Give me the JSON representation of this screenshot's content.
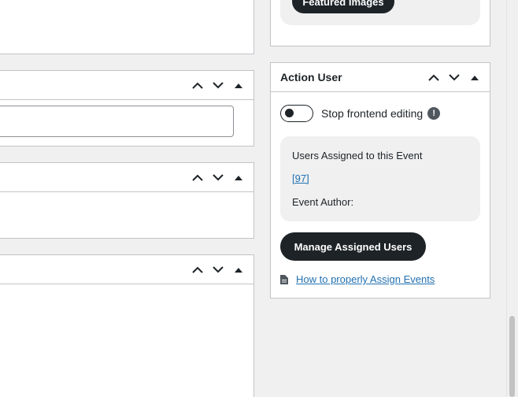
{
  "images_box": {
    "button_label": "Featured Images"
  },
  "action_user": {
    "title": "Action User",
    "toggle_label": "Stop frontend editing",
    "info_badge": "!",
    "assigned_heading": "Users Assigned to this Event",
    "assigned_ids": "[97]",
    "author_label": "Event Author:",
    "manage_button": "Manage Assigned Users",
    "help_link": "How to properly Assign Events"
  },
  "toggle_state": {
    "stop_frontend_editing": false
  },
  "colors": {
    "accent_dark": "#1d2327",
    "link": "#2271b1",
    "border": "#c3c4c7",
    "background": "#f0f0f1"
  },
  "icons": {
    "move_up": "chevron-up-icon",
    "move_down": "chevron-down-icon",
    "toggle_panel": "caret-up-icon",
    "document": "document-icon",
    "info": "info-icon"
  }
}
